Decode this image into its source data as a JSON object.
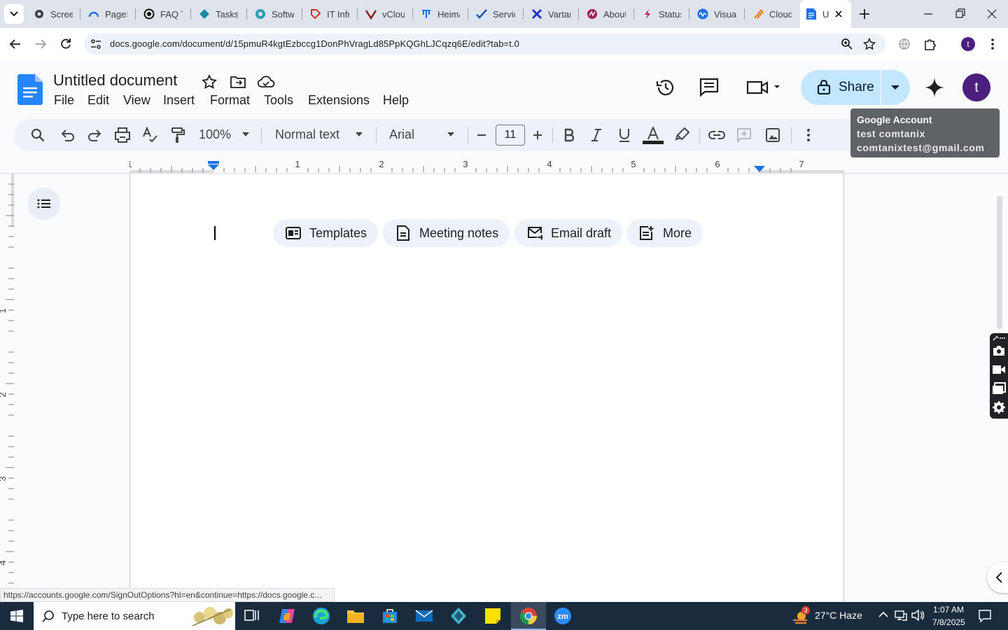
{
  "tabs": [
    {
      "label": "Scree",
      "icon": "gear-icon"
    },
    {
      "label": "PageS",
      "icon": "pagespeed-icon"
    },
    {
      "label": "FAQ T",
      "icon": "circle-icon"
    },
    {
      "label": "Tasks",
      "icon": "tasks-icon"
    },
    {
      "label": "Softw",
      "icon": "hexagon-icon"
    },
    {
      "label": "IT Infr",
      "icon": "tag-icon"
    },
    {
      "label": "vClou",
      "icon": "v-logo-icon"
    },
    {
      "label": "Heima",
      "icon": "org-icon"
    },
    {
      "label": "Servic",
      "icon": "check-icon"
    },
    {
      "label": "Vartar",
      "icon": "x-logo-icon"
    },
    {
      "label": "About",
      "icon": "zigzag-icon"
    },
    {
      "label": "Status",
      "icon": "bolt-icon"
    },
    {
      "label": "Visual",
      "icon": "wave-icon"
    },
    {
      "label": "Cloud",
      "icon": "slash-icon"
    },
    {
      "label": "U",
      "icon": "docs-icon"
    }
  ],
  "address": {
    "url": "docs.google.com/document/d/15pmuR4kgtEzbccg1DonPhVragLd85PpKQGhLJCqzq6E/edit?tab=t.0"
  },
  "docs": {
    "title": "Untitled document",
    "menu": [
      "File",
      "Edit",
      "View",
      "Insert",
      "Format",
      "Tools",
      "Extensions",
      "Help"
    ],
    "share_label": "Share",
    "avatar_letter": "t"
  },
  "toolbar": {
    "zoom": "100%",
    "style": "Normal text",
    "font": "Arial",
    "font_size": "11"
  },
  "tooltip": {
    "title": "Google Account",
    "name": "test comtanix",
    "email": "comtanixtest@gmail.com"
  },
  "ruler": {
    "h_labels": [
      "1",
      "1",
      "2",
      "3",
      "4",
      "5",
      "6",
      "7"
    ],
    "v_labels": [
      "1",
      "2",
      "3",
      "4"
    ]
  },
  "chips": [
    {
      "label": "Templates",
      "icon": "templates-icon"
    },
    {
      "label": "Meeting notes",
      "icon": "document-icon"
    },
    {
      "label": "Email draft",
      "icon": "email-icon"
    },
    {
      "label": "More",
      "icon": "add-note-icon"
    }
  ],
  "status_url": "https://accounts.google.com/SignOutOptions?hl=en&continue=https://docs.google.c...",
  "taskbar": {
    "search_placeholder": "Type here to search",
    "weather": "27°C  Haze",
    "weather_badge": "3",
    "time": "1:07 AM",
    "date": "7/8/2025"
  },
  "colors": {
    "accent": "#0b57d0",
    "share_bg": "#c2e7ff",
    "avatar": "#4a1f7d",
    "taskbar": "#1a2b3e"
  }
}
